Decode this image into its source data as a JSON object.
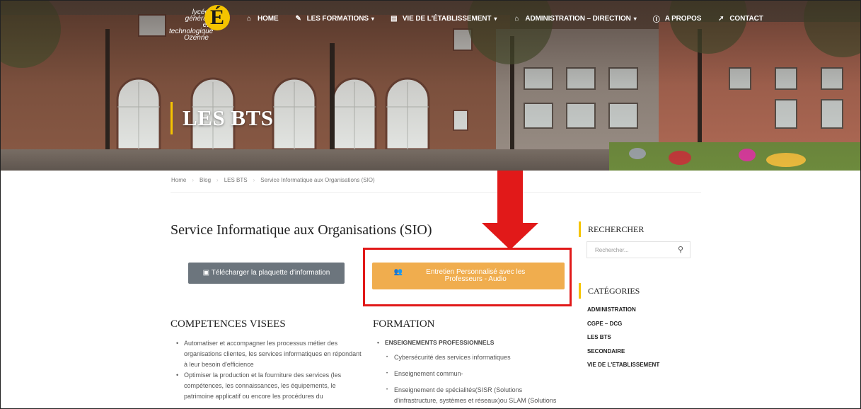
{
  "logo": {
    "text_lines": [
      "lycée général",
      "et technologique",
      "Ozenne"
    ],
    "mark": "É"
  },
  "nav": [
    {
      "icon": "home-icon",
      "glyph": "⌂",
      "label": "HOME",
      "dropdown": false
    },
    {
      "icon": "graduation-cap-icon",
      "glyph": "✎",
      "label": "LES FORMATIONS",
      "dropdown": true
    },
    {
      "icon": "building-icon",
      "glyph": "▤",
      "label": "VIE DE L'ÉTABLISSEMENT",
      "dropdown": true
    },
    {
      "icon": "university-icon",
      "glyph": "⌂",
      "label": "ADMINISTRATION – DIRECTION",
      "dropdown": true
    },
    {
      "icon": "info-circle-icon",
      "glyph": "ⓘ",
      "label": "A PROPOS",
      "dropdown": false
    },
    {
      "icon": "send-icon",
      "glyph": "➚",
      "label": "CONTACT",
      "dropdown": false
    }
  ],
  "hero": {
    "title": "LES BTS"
  },
  "breadcrumb": [
    "Home",
    "Blog",
    "LES BTS",
    "Service Informatique aux Organisations (SIO)"
  ],
  "main": {
    "title": "Service Informatique aux Organisations (SIO)",
    "download_button": "Télécharger la plaquette d'information",
    "interview_button": "Entretien Personnalisé avec les Professeurs - Audio",
    "competences": {
      "heading": "COMPETENCES VISEES",
      "items": [
        "Automatiser et accompagner les processus métier des organisations clientes, les services informatiques en répondant à leur besoin d'efficience",
        "Optimiser la production et la fourniture des services (les compétences, les connaissances, les équipements, le patrimoine applicatif ou encore les procédures du"
      ]
    },
    "formation": {
      "heading": "FORMATION",
      "item": "ENSEIGNEMENTS PROFESSIONNELS",
      "subitems": [
        "Cybersécurité des services informatiques",
        "Enseignement commun-",
        "Enseignement de spécialités(SISR (Solutions d'infrastructure, systèmes et réseaux)ou SLAM (Solutions logicielles, applications"
      ]
    }
  },
  "sidebar": {
    "search_heading": "RECHERCHER",
    "search_placeholder": "Rechercher...",
    "categories_heading": "CATÉGORIES",
    "categories": [
      "ADMINISTRATION",
      "CGPE – DCG",
      "LES BTS",
      "SECONDAIRE",
      "VIE DE L'ETABLISSEMENT"
    ]
  },
  "colors": {
    "accent": "#f5c400",
    "orange_button": "#f0ad4e",
    "grey_button": "#6c757d",
    "annotation_red": "#e11919"
  }
}
